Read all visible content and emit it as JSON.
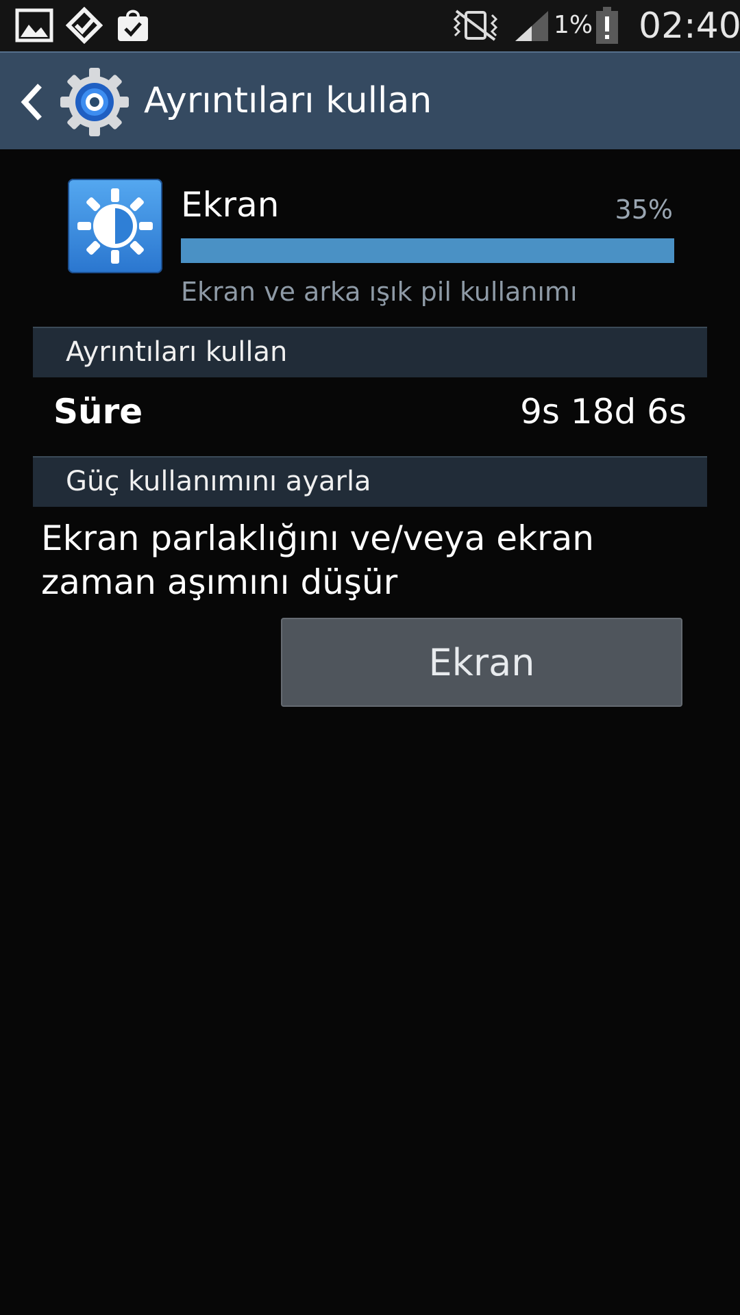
{
  "status_bar": {
    "battery": "1%",
    "time": "02:40",
    "icons": [
      "gallery-icon",
      "foursquare-icon",
      "shopping-bag-check-icon",
      "vibrate-off-icon",
      "signal-icon",
      "battery-alert-icon"
    ]
  },
  "action_bar": {
    "title": "Ayrıntıları kullan",
    "back_icon": "back-chevron-icon",
    "app_icon": "settings-gear-icon"
  },
  "usage_item": {
    "name": "Ekran",
    "percent_label": "35%",
    "percent_value": 35,
    "description": "Ekran ve arka ışık pil kullanımı",
    "icon": "brightness-icon"
  },
  "details_section": {
    "header": "Ayrıntıları kullan",
    "duration_label": "Süre",
    "duration_value": "9s 18d 6s"
  },
  "power_section": {
    "header": "Güç kullanımını ayarla",
    "tip": "Ekran parlaklığını ve/veya ekran zaman aşımını düşür",
    "button_label": "Ekran"
  },
  "colors": {
    "action_bar": "#354a61",
    "progress": "#4a91c5",
    "section_header": "#212c38",
    "button": "#4f555c"
  }
}
